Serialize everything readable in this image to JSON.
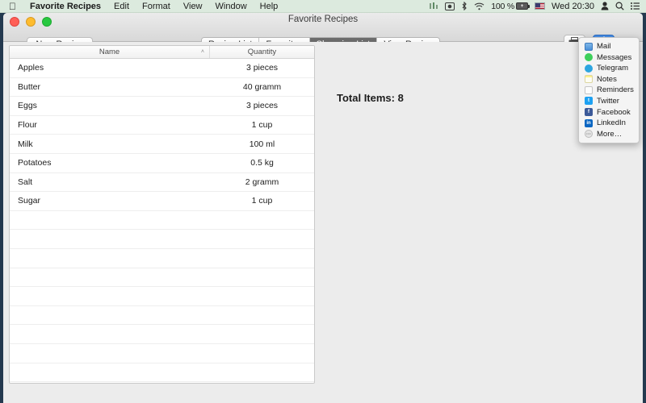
{
  "menubar": {
    "apple_icon": "apple-icon",
    "app_name": "Favorite Recipes",
    "items": [
      "Edit",
      "Format",
      "View",
      "Window",
      "Help"
    ],
    "status": {
      "equalizer_icon": "equalizer-icon",
      "screenshot_icon": "screenshot-icon",
      "bluetooth_icon": "bluetooth-icon",
      "wifi_icon": "wifi-icon",
      "battery_percent": "100 %",
      "battery_badge": "+",
      "flag_icon": "us-flag-icon",
      "clock": "Wed 20:30",
      "user_icon": "user-icon",
      "search_icon": "search-icon",
      "list_icon": "control-center-icon"
    }
  },
  "window": {
    "title": "Favorite Recipes",
    "traffic_lights": [
      "close-button",
      "minimize-button",
      "zoom-button"
    ]
  },
  "toolbar": {
    "new_recipe_label": "New Recipe",
    "tabs": [
      {
        "label": "Recipe List",
        "active": false
      },
      {
        "label": "Favorites",
        "active": false
      },
      {
        "label": "Shopping List",
        "active": true
      },
      {
        "label": "View Recipe",
        "active": false
      }
    ],
    "print_icon": "print-icon",
    "share_icon": "share-icon",
    "help_label": "?"
  },
  "table": {
    "columns": [
      "Name",
      "Quantity"
    ],
    "sort_column": "Name",
    "sort_arrow": "˄",
    "rows": [
      {
        "name": "Apples",
        "quantity": "3 pieces"
      },
      {
        "name": "Butter",
        "quantity": "40 gramm"
      },
      {
        "name": "Eggs",
        "quantity": "3 pieces"
      },
      {
        "name": "Flour",
        "quantity": "1 cup"
      },
      {
        "name": "Milk",
        "quantity": "100 ml"
      },
      {
        "name": "Potatoes",
        "quantity": "0.5 kg"
      },
      {
        "name": "Salt",
        "quantity": "2 gramm"
      },
      {
        "name": "Sugar",
        "quantity": "1 cup"
      }
    ],
    "empty_row_count": 9
  },
  "detail": {
    "total_items_label": "Total Items: 8"
  },
  "share_menu": {
    "items": [
      {
        "label": "Mail",
        "icon": "mail-icon"
      },
      {
        "label": "Messages",
        "icon": "messages-icon"
      },
      {
        "label": "Telegram",
        "icon": "telegram-icon"
      },
      {
        "label": "Notes",
        "icon": "notes-icon"
      },
      {
        "label": "Reminders",
        "icon": "reminders-icon"
      },
      {
        "label": "Twitter",
        "icon": "twitter-icon"
      },
      {
        "label": "Facebook",
        "icon": "facebook-icon"
      },
      {
        "label": "LinkedIn",
        "icon": "linkedin-icon"
      },
      {
        "label": "More…",
        "icon": "more-icon"
      }
    ]
  },
  "colors": {
    "menubar_bg": "#dceade",
    "accent_blue": "#2f7ada",
    "active_tab_bg": "#656565",
    "desktop": "#24394f"
  }
}
